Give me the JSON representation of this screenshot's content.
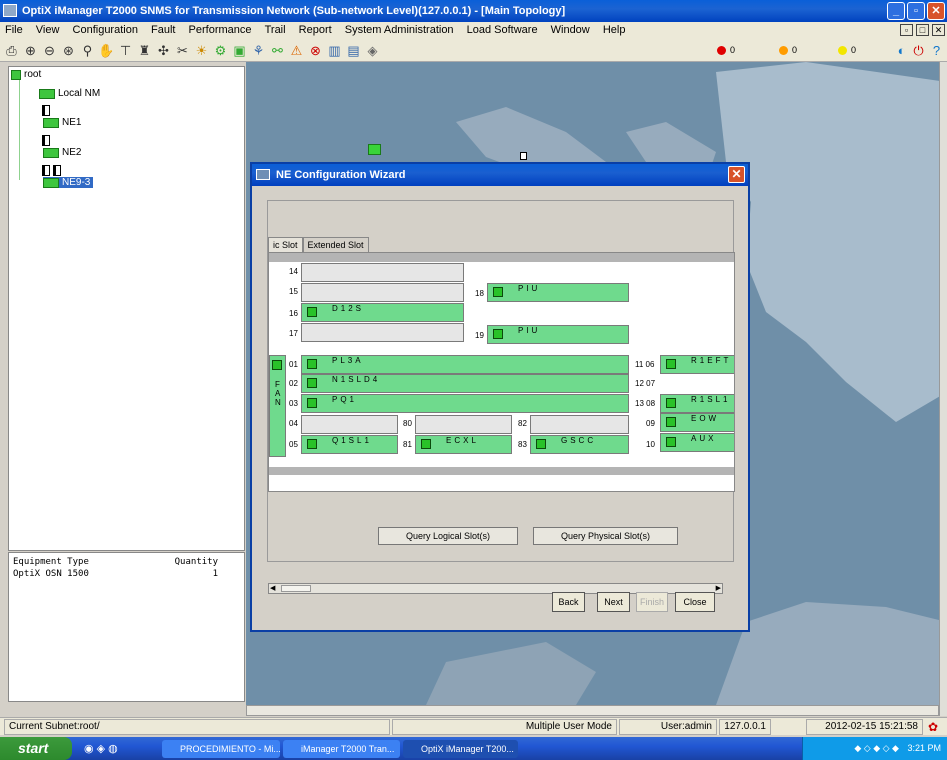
{
  "window": {
    "title": "OptiX iManager T2000 SNMS for Transmission Network (Sub-network Level)(127.0.0.1) - [Main Topology]"
  },
  "menu": [
    "File",
    "View",
    "Configuration",
    "Fault",
    "Performance",
    "Trail",
    "Report",
    "System Administration",
    "Load Software",
    "Window",
    "Help"
  ],
  "alarms": [
    {
      "color": "#e00000",
      "count": "0"
    },
    {
      "color": "#ff9c00",
      "count": "0"
    },
    {
      "color": "#f2e600",
      "count": "0"
    }
  ],
  "tree": {
    "root": "root",
    "local_nm": "Local NM",
    "ne1": "NE1",
    "ne2": "NE2",
    "ne9": "NE9-3"
  },
  "equipment": {
    "col_type": "Equipment Type",
    "col_qty": "Quantity",
    "rows": [
      {
        "type": "OptiX OSN 1500",
        "qty": "1"
      }
    ]
  },
  "dialog": {
    "title": "NE Configuration Wizard",
    "tab_basic": "ic Slot",
    "tab_extended": "Extended Slot",
    "fan_label": "FAN",
    "slots": {
      "s14": {
        "num": "14",
        "board": ""
      },
      "s15": {
        "num": "15",
        "board": ""
      },
      "s16": {
        "num": "16",
        "board": "D12S"
      },
      "s17": {
        "num": "17",
        "board": ""
      },
      "s18": {
        "num": "18",
        "board": "PIU"
      },
      "s19": {
        "num": "19",
        "board": "PIU"
      },
      "s01": {
        "num": "01",
        "board": "PL3A"
      },
      "s02": {
        "num": "02",
        "board": "N1SLD4"
      },
      "s03": {
        "num": "03",
        "board": "PQ1"
      },
      "s04": {
        "num": "04",
        "board": ""
      },
      "s05": {
        "num": "05",
        "board": "Q1SL1"
      },
      "s80": {
        "num": "80",
        "board": ""
      },
      "s81": {
        "num": "81",
        "board": "ECXL"
      },
      "s82": {
        "num": "82",
        "board": ""
      },
      "s83": {
        "num": "83",
        "board": "GSCC"
      },
      "s11": {
        "num": "11 06",
        "board": "R1EFT"
      },
      "s12": {
        "num": "12 07",
        "board": ""
      },
      "s13": {
        "num": "13 08",
        "board": "R1SL1"
      },
      "s09": {
        "num": "09",
        "board": "EOW"
      },
      "s10": {
        "num": "10",
        "board": "AUX"
      }
    },
    "query_logical": "Query Logical Slot(s)",
    "query_physical": "Query Physical Slot(s)",
    "back": "Back",
    "next": "Next",
    "finish": "Finish",
    "close": "Close"
  },
  "status": {
    "subnet": "Current Subnet:root/",
    "mode": "Multiple User Mode",
    "user": "User:admin",
    "ip": "127.0.0.1",
    "datetime": "2012-02-15 15:21:58"
  },
  "taskbar": {
    "start": "start",
    "items": [
      "PROCEDIMIENTO - Mi...",
      "iManager T2000 Tran...",
      "OptiX iManager T200..."
    ],
    "clock": "3:21 PM"
  }
}
